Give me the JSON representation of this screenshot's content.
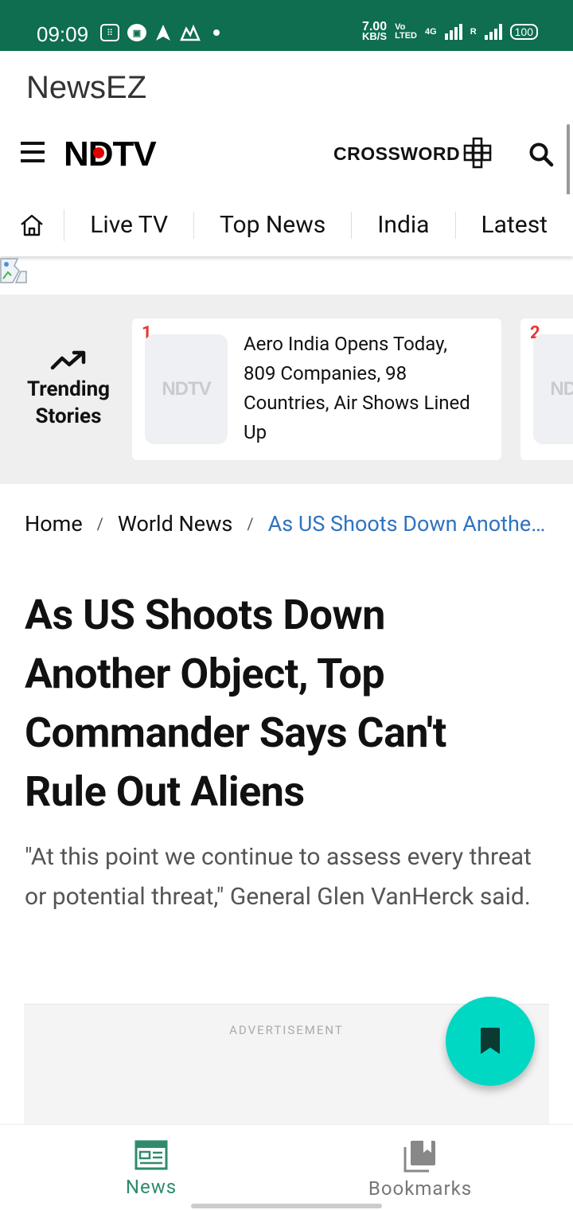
{
  "status_bar": {
    "time": "09:09",
    "speed_value": "7.00",
    "speed_unit": "KB/S",
    "volte_top": "Vo",
    "volte_bottom": "LTED",
    "network": "4G",
    "roaming": "R",
    "battery": "100"
  },
  "app": {
    "title": "NewsEZ"
  },
  "header": {
    "logo": "NDTV",
    "crossword_label": "CROSSWORD"
  },
  "nav": {
    "tabs": [
      "Live TV",
      "Top News",
      "India",
      "Latest"
    ]
  },
  "trending": {
    "label_line1": "Trending",
    "label_line2": "Stories",
    "items": [
      {
        "rank": "1",
        "title": "Aero India Opens Today, 809 Companies, 98 Countries, Air Shows Lined Up",
        "thumb_text": "NDTV"
      },
      {
        "rank": "2",
        "title": "",
        "thumb_text": "NDTV"
      }
    ]
  },
  "breadcrumb": {
    "home": "Home",
    "section": "World News",
    "current": "As US Shoots Down Another Object, Top Commander Says Can't Rule Out Aliens",
    "separator": "/"
  },
  "article": {
    "headline": "As US Shoots Down Another Object, Top Commander Says Can't Rule Out Aliens",
    "subtitle": "\"At this point we continue to assess every threat or potential threat,\" General Glen VanHerck said."
  },
  "ad": {
    "label": "ADVERTISEMENT"
  },
  "bottom_nav": {
    "items": [
      {
        "label": "News",
        "active": true
      },
      {
        "label": "Bookmarks",
        "active": false
      }
    ]
  },
  "colors": {
    "status_bar": "#0e6e4f",
    "accent_teal": "#00d8c4",
    "active_tab": "#2e8b6e",
    "link_blue": "#2f73c0",
    "rank_red": "#e53935"
  }
}
